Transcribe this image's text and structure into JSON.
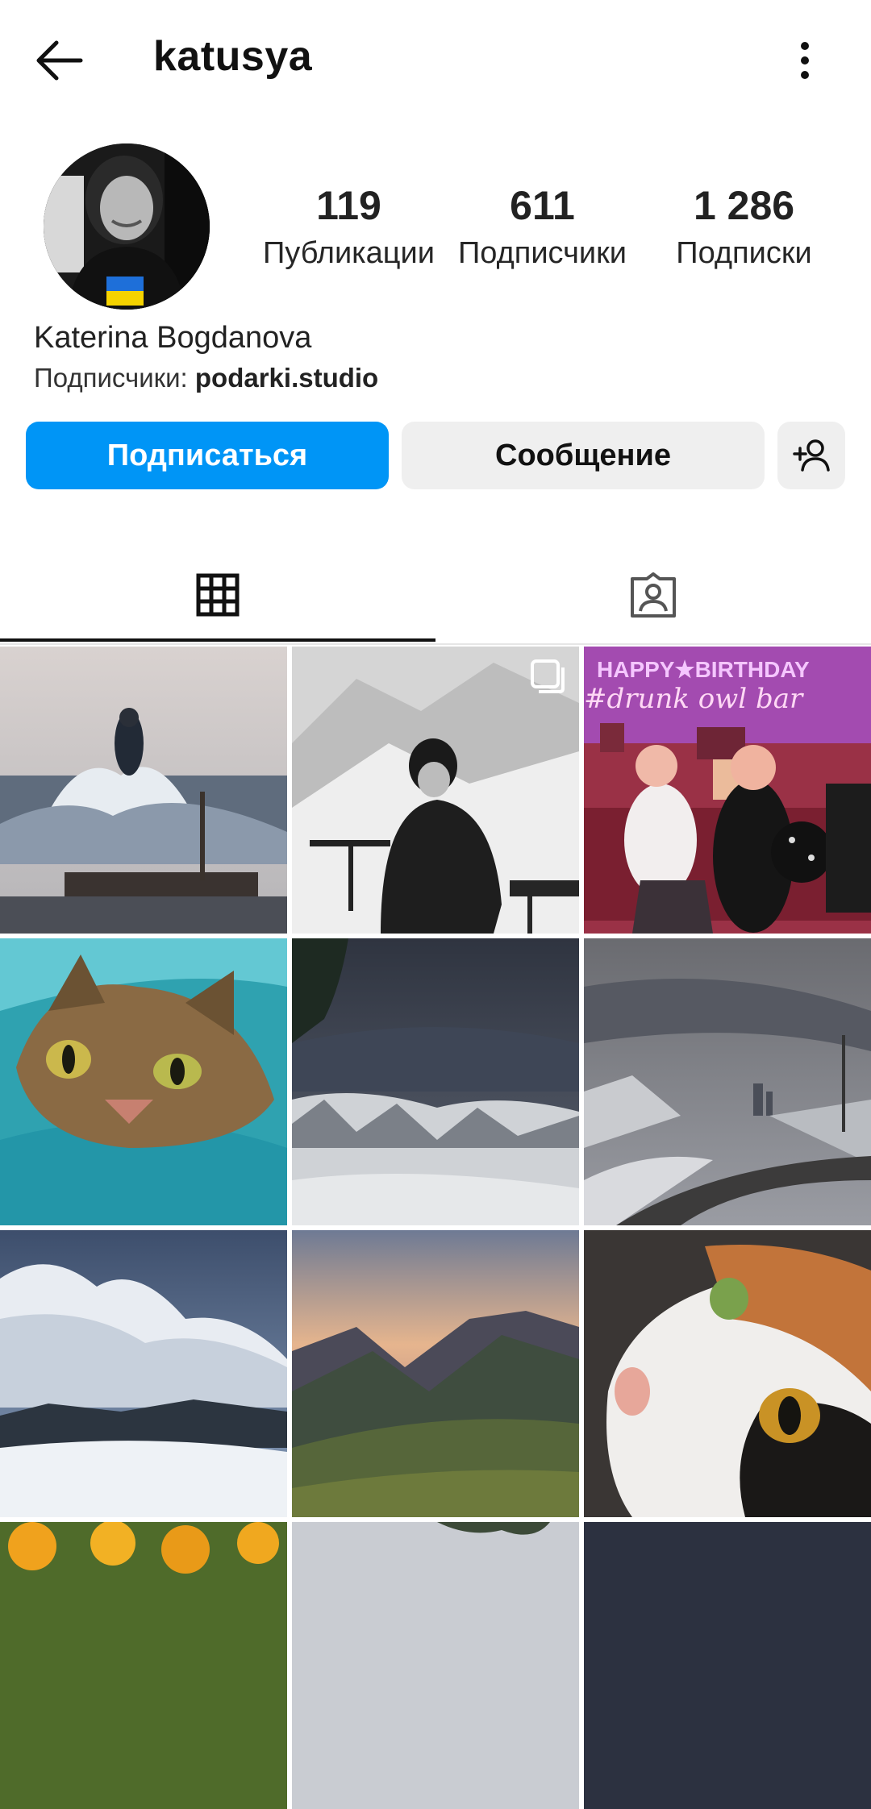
{
  "header": {
    "username": "katusya",
    "back_icon": "arrow-left-icon",
    "more_icon": "more-vertical-icon"
  },
  "profile": {
    "full_name": "Katerina Bogdanova",
    "followed_by_label": "Подписчики: ",
    "followed_by_user": "podarki.studio",
    "stats": {
      "posts": {
        "value": "119",
        "label": "Публикации"
      },
      "followers": {
        "value": "611",
        "label": "Подписчики"
      },
      "following": {
        "value": "1 286",
        "label": "Подписки"
      }
    }
  },
  "actions": {
    "follow_label": "Подписаться",
    "message_label": "Сообщение",
    "add_user_icon": "add-user-icon",
    "accent_color": "#0095f6"
  },
  "tabs": [
    {
      "icon": "grid-icon",
      "active": true
    },
    {
      "icon": "tagged-user-icon",
      "active": false
    }
  ],
  "overlay_text": {
    "banner": "HAPPY★BIRTHDAY",
    "neon": "#drunk owl bar"
  },
  "posts": [
    {
      "scene": "sea-splash"
    },
    {
      "scene": "snow-mountain-bw",
      "multi": true
    },
    {
      "scene": "birthday-party"
    },
    {
      "scene": "tabby-cat"
    },
    {
      "scene": "winter-storm-forest"
    },
    {
      "scene": "winter-road-city"
    },
    {
      "scene": "snowy-clouds"
    },
    {
      "scene": "mountain-sunset"
    },
    {
      "scene": "calico-cat"
    },
    {
      "scene": "oranges"
    },
    {
      "scene": "sky-trees"
    },
    {
      "scene": "dark-sky"
    }
  ]
}
